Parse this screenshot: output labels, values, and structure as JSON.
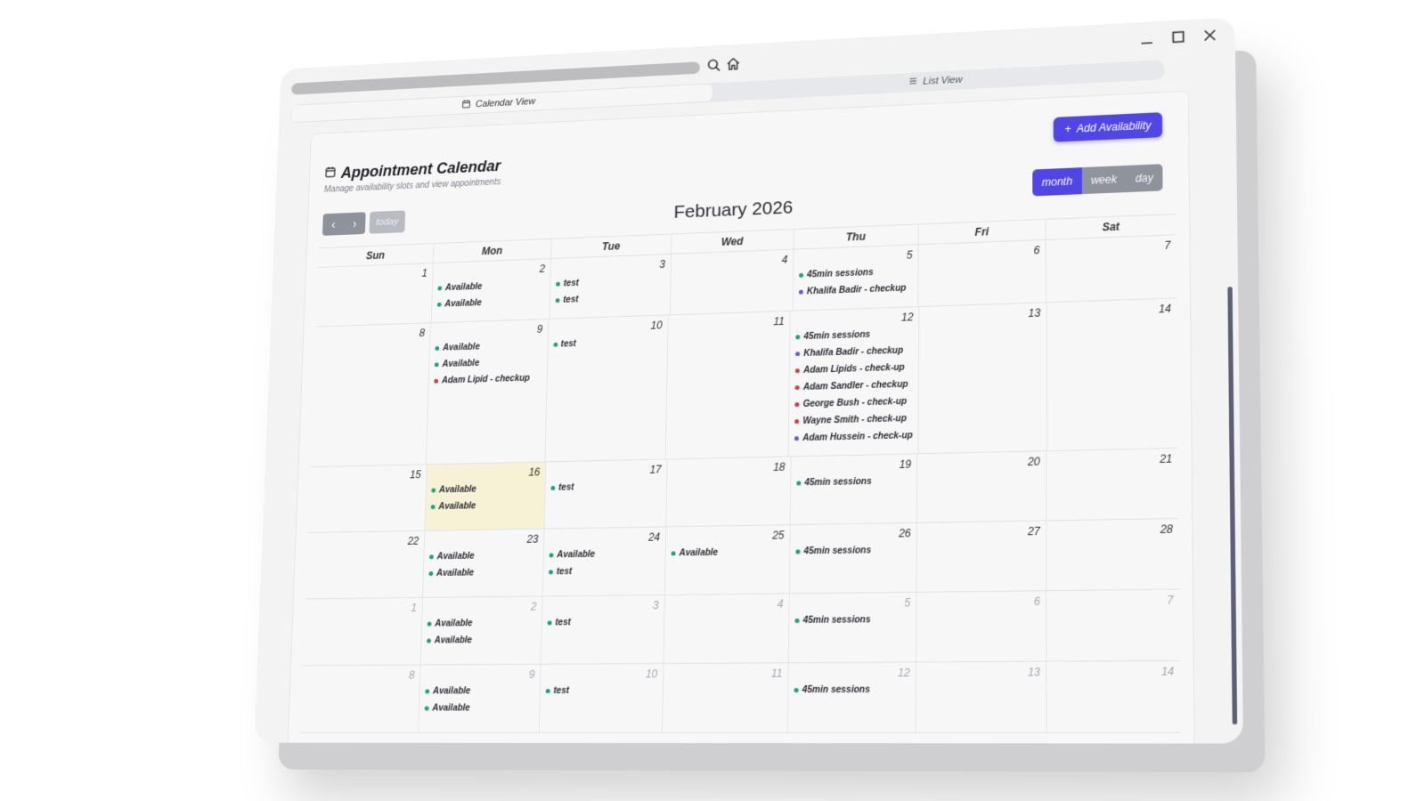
{
  "colors": {
    "accent": "#4f46e5",
    "today_bg": "#f7f1d6",
    "dot_green": "#16a37a",
    "dot_purple": "#6d55d4",
    "dot_red": "#d33a4b"
  },
  "window": {
    "icons": {
      "minimize": "minimize-icon",
      "maximize": "maximize-icon",
      "close": "close-icon",
      "search": "search-icon",
      "home": "home-icon"
    }
  },
  "tabs": [
    {
      "label": "Calendar View",
      "icon": "calendar-icon",
      "active": true
    },
    {
      "label": "List View",
      "icon": "list-icon",
      "active": false
    }
  ],
  "header": {
    "title": "Appointment Calendar",
    "subtitle": "Manage availability slots and view appointments",
    "add_button": "Add Availability"
  },
  "toolbar": {
    "today": "today",
    "prev_icon": "chevron-left-icon",
    "next_icon": "chevron-right-icon",
    "month_title": "February 2026",
    "views": [
      "month",
      "week",
      "day"
    ],
    "active_view": "month"
  },
  "calendar": {
    "weekdays": [
      "Sun",
      "Mon",
      "Tue",
      "Wed",
      "Thu",
      "Fri",
      "Sat"
    ],
    "weeks": [
      {
        "height": 70,
        "days": [
          {
            "num": "1",
            "events": []
          },
          {
            "num": "2",
            "events": [
              {
                "label": "Available",
                "color": "green"
              },
              {
                "label": "Available",
                "color": "green"
              }
            ]
          },
          {
            "num": "3",
            "events": [
              {
                "label": "test",
                "color": "green"
              },
              {
                "label": "test",
                "color": "green"
              }
            ]
          },
          {
            "num": "4",
            "events": []
          },
          {
            "num": "5",
            "events": [
              {
                "label": "45min sessions",
                "color": "green"
              },
              {
                "label": "Khalifa Badir - checkup",
                "color": "purple"
              }
            ]
          },
          {
            "num": "6",
            "events": []
          },
          {
            "num": "7",
            "events": []
          }
        ]
      },
      {
        "height": 164,
        "days": [
          {
            "num": "8",
            "events": []
          },
          {
            "num": "9",
            "events": [
              {
                "label": "Available",
                "color": "green"
              },
              {
                "label": "Available",
                "color": "green"
              },
              {
                "label": "Adam Lipid - checkup",
                "color": "red"
              }
            ]
          },
          {
            "num": "10",
            "events": [
              {
                "label": "test",
                "color": "green"
              }
            ]
          },
          {
            "num": "11",
            "events": []
          },
          {
            "num": "12",
            "events": [
              {
                "label": "45min sessions",
                "color": "green"
              },
              {
                "label": "Khalifa Badir - checkup",
                "color": "purple"
              },
              {
                "label": "Adam Lipids - check-up",
                "color": "red"
              },
              {
                "label": "Adam Sandler - checkup",
                "color": "red"
              },
              {
                "label": "George Bush - check-up",
                "color": "red"
              },
              {
                "label": "Wayne Smith - check-up",
                "color": "red"
              },
              {
                "label": "Adam Hussein - check-up",
                "color": "purple"
              }
            ]
          },
          {
            "num": "13",
            "events": []
          },
          {
            "num": "14",
            "events": []
          }
        ]
      },
      {
        "height": 76,
        "days": [
          {
            "num": "15",
            "events": []
          },
          {
            "num": "16",
            "today": true,
            "events": [
              {
                "label": "Available",
                "color": "green"
              },
              {
                "label": "Available",
                "color": "green"
              }
            ]
          },
          {
            "num": "17",
            "events": [
              {
                "label": "test",
                "color": "green"
              }
            ]
          },
          {
            "num": "18",
            "events": []
          },
          {
            "num": "19",
            "events": [
              {
                "label": "45min sessions",
                "color": "green"
              }
            ]
          },
          {
            "num": "20",
            "events": []
          },
          {
            "num": "21",
            "events": []
          }
        ]
      },
      {
        "height": 76,
        "days": [
          {
            "num": "22",
            "events": []
          },
          {
            "num": "23",
            "events": [
              {
                "label": "Available",
                "color": "green"
              },
              {
                "label": "Available",
                "color": "green"
              }
            ]
          },
          {
            "num": "24",
            "events": [
              {
                "label": "Available",
                "color": "green"
              },
              {
                "label": "test",
                "color": "green"
              }
            ]
          },
          {
            "num": "25",
            "events": [
              {
                "label": "Available",
                "color": "green"
              }
            ]
          },
          {
            "num": "26",
            "events": [
              {
                "label": "45min sessions",
                "color": "green"
              }
            ]
          },
          {
            "num": "27",
            "events": []
          },
          {
            "num": "28",
            "events": []
          }
        ]
      },
      {
        "height": 76,
        "days": [
          {
            "num": "1",
            "other": true,
            "events": []
          },
          {
            "num": "2",
            "other": true,
            "events": [
              {
                "label": "Available",
                "color": "green"
              },
              {
                "label": "Available",
                "color": "green"
              }
            ]
          },
          {
            "num": "3",
            "other": true,
            "events": [
              {
                "label": "test",
                "color": "green"
              }
            ]
          },
          {
            "num": "4",
            "other": true,
            "events": []
          },
          {
            "num": "5",
            "other": true,
            "events": [
              {
                "label": "45min sessions",
                "color": "green"
              }
            ]
          },
          {
            "num": "6",
            "other": true,
            "events": []
          },
          {
            "num": "7",
            "other": true,
            "events": []
          }
        ]
      },
      {
        "height": 76,
        "days": [
          {
            "num": "8",
            "other": true,
            "events": []
          },
          {
            "num": "9",
            "other": true,
            "events": [
              {
                "label": "Available",
                "color": "green"
              },
              {
                "label": "Available",
                "color": "green"
              }
            ]
          },
          {
            "num": "10",
            "other": true,
            "events": [
              {
                "label": "test",
                "color": "green"
              }
            ]
          },
          {
            "num": "11",
            "other": true,
            "events": []
          },
          {
            "num": "12",
            "other": true,
            "events": [
              {
                "label": "45min sessions",
                "color": "green"
              }
            ]
          },
          {
            "num": "13",
            "other": true,
            "events": []
          },
          {
            "num": "14",
            "other": true,
            "events": []
          }
        ]
      }
    ]
  }
}
